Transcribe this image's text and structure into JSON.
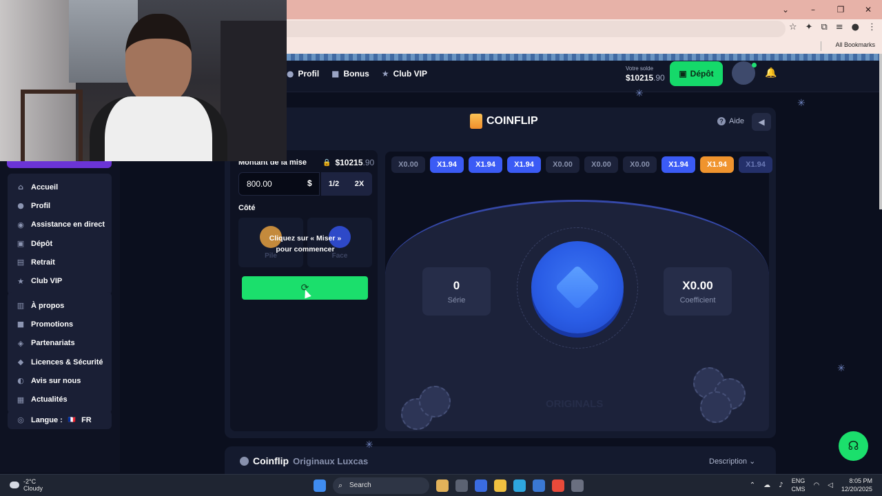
{
  "browser": {
    "window_controls": [
      "⌄",
      "–",
      "❐",
      "✕"
    ],
    "bookmarks_label": "All Bookmarks",
    "toolbar_icons": [
      "☆",
      "✦",
      "⧉",
      "≡",
      "●",
      "⋮"
    ]
  },
  "header": {
    "nav": [
      {
        "icon": "user-icon",
        "label": "Profil"
      },
      {
        "icon": "gift-icon",
        "label": "Bonus"
      },
      {
        "icon": "star-icon",
        "label": "Club VIP"
      }
    ],
    "balance_label": "Votre solde",
    "balance_whole": "$10215",
    "balance_decimal": ".90",
    "deposit_label": "Dépôt"
  },
  "sidebar": {
    "group1": [
      {
        "icon": "home-icon",
        "label": "Accueil"
      },
      {
        "icon": "user-icon",
        "label": "Profil"
      },
      {
        "icon": "chat-icon",
        "label": "Assistance en direct"
      },
      {
        "icon": "wallet-icon",
        "label": "Dépôt"
      },
      {
        "icon": "withdraw-icon",
        "label": "Retrait"
      },
      {
        "icon": "star-icon",
        "label": "Club VIP"
      }
    ],
    "group2": [
      {
        "icon": "book-icon",
        "label": "À propos"
      },
      {
        "icon": "gift-icon",
        "label": "Promotions"
      },
      {
        "icon": "handshake-icon",
        "label": "Partenariats"
      },
      {
        "icon": "shield-icon",
        "label": "Licences & Sécurité"
      },
      {
        "icon": "review-icon",
        "label": "Avis sur nous"
      },
      {
        "icon": "news-icon",
        "label": "Actualités"
      }
    ],
    "language_label": "Langue :",
    "language_value": "FR",
    "language_flag": "🇫🇷"
  },
  "game": {
    "title": "COINFLIP",
    "help_label": "Aide",
    "bet_label": "Montant de la mise",
    "bet_balance_whole": "$10215",
    "bet_balance_decimal": ".90",
    "bet_amount": "800.00",
    "currency": "$",
    "half_label": "1/2",
    "double_label": "2X",
    "side_label": "Côté",
    "side_options": [
      "Pile",
      "Face"
    ],
    "hint_line1": "Cliquez sur « Miser »",
    "hint_line2": "pour commencer",
    "bet_button_icon": "⟳",
    "history": [
      {
        "value": "X0.00",
        "style": "neutral"
      },
      {
        "value": "X1.94",
        "style": "blue"
      },
      {
        "value": "X1.94",
        "style": "blue"
      },
      {
        "value": "X1.94",
        "style": "blue"
      },
      {
        "value": "X0.00",
        "style": "neutral"
      },
      {
        "value": "X0.00",
        "style": "neutral"
      },
      {
        "value": "X0.00",
        "style": "neutral"
      },
      {
        "value": "X1.94",
        "style": "blue"
      },
      {
        "value": "X1.94",
        "style": "orange"
      },
      {
        "value": "X1.94",
        "style": "fade"
      }
    ],
    "streak_value": "0",
    "streak_label": "Série",
    "coefficient_value": "X0.00",
    "coefficient_label": "Coefficient",
    "watermark": "ORIGINALS"
  },
  "description": {
    "title": "Coinflip",
    "subtitle": "Originaux Luxcas",
    "toggle_label": "Description"
  },
  "taskbar": {
    "temperature": "-2°C",
    "condition": "Cloudy",
    "search_label": "Search",
    "lang_top": "ENG",
    "lang_bottom": "CMS",
    "time": "8:05 PM",
    "date": "12/20/2025"
  },
  "colors": {
    "accent_green": "#1bdf6c",
    "chip_blue": "#3b5bf5",
    "chip_orange": "#f0942e"
  }
}
